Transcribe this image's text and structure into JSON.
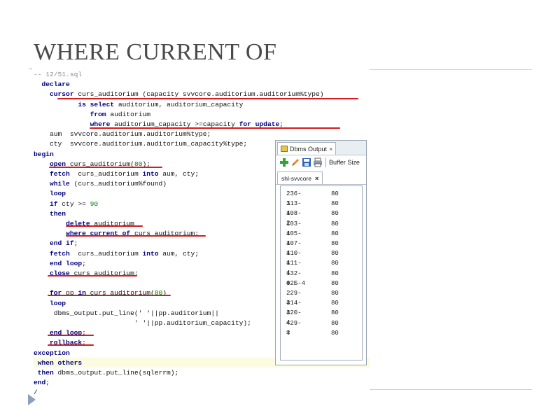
{
  "slide": {
    "title": "WHERE CURRENT OF"
  },
  "code": {
    "lines": [
      {
        "parts": [
          {
            "t": "-- 12/51.sql",
            "c": "cm"
          }
        ]
      },
      {
        "parts": [
          {
            "t": "  "
          },
          {
            "t": "declare",
            "c": "kw"
          }
        ]
      },
      {
        "parts": [
          {
            "t": "    "
          },
          {
            "t": "cursor",
            "c": "kw"
          },
          {
            "t": " curs_auditorium (capacity svvcore.auditorium.auditorium%type)"
          }
        ]
      },
      {
        "parts": [
          {
            "t": "           "
          },
          {
            "t": "is select",
            "c": "kw"
          },
          {
            "t": " auditorium, auditorium_capacity"
          }
        ]
      },
      {
        "parts": [
          {
            "t": "              "
          },
          {
            "t": "from",
            "c": "kw"
          },
          {
            "t": " auditorium"
          }
        ]
      },
      {
        "parts": [
          {
            "t": "              "
          },
          {
            "t": "where",
            "c": "kw"
          },
          {
            "t": " auditorium_capacity >=capacity "
          },
          {
            "t": "for update",
            "c": "kw"
          },
          {
            "t": ";"
          }
        ]
      },
      {
        "parts": [
          {
            "t": "    aum  svvcore.auditorium.auditorium%type;"
          }
        ]
      },
      {
        "parts": [
          {
            "t": "    cty  svvcore.auditorium.auditorium_capacity%type;"
          }
        ]
      },
      {
        "parts": [
          {
            "t": "begin",
            "c": "kw"
          }
        ]
      },
      {
        "parts": [
          {
            "t": "    "
          },
          {
            "t": "open",
            "c": "kw"
          },
          {
            "t": " curs_auditorium("
          },
          {
            "t": "80",
            "c": "num"
          },
          {
            "t": ");"
          }
        ]
      },
      {
        "parts": [
          {
            "t": "    "
          },
          {
            "t": "fetch",
            "c": "kw"
          },
          {
            "t": "  curs_auditorium "
          },
          {
            "t": "into",
            "c": "kw"
          },
          {
            "t": " aum, cty;"
          }
        ]
      },
      {
        "parts": [
          {
            "t": "    "
          },
          {
            "t": "while",
            "c": "kw"
          },
          {
            "t": " (curs_auditorium%found)"
          }
        ]
      },
      {
        "parts": [
          {
            "t": "    "
          },
          {
            "t": "loop",
            "c": "kw"
          }
        ]
      },
      {
        "parts": [
          {
            "t": "    "
          },
          {
            "t": "if",
            "c": "kw"
          },
          {
            "t": " cty >= "
          },
          {
            "t": "90",
            "c": "num"
          }
        ]
      },
      {
        "parts": [
          {
            "t": "    "
          },
          {
            "t": "then",
            "c": "kw"
          }
        ]
      },
      {
        "parts": [
          {
            "t": "        "
          },
          {
            "t": "delete",
            "c": "kw"
          },
          {
            "t": " auditorium"
          }
        ]
      },
      {
        "parts": [
          {
            "t": "        "
          },
          {
            "t": "where current of",
            "c": "kw"
          },
          {
            "t": " curs auditorium;"
          }
        ]
      },
      {
        "parts": [
          {
            "t": "    "
          },
          {
            "t": "end if",
            "c": "kw"
          },
          {
            "t": ";"
          }
        ]
      },
      {
        "parts": [
          {
            "t": "    "
          },
          {
            "t": "fetch",
            "c": "kw"
          },
          {
            "t": "  curs_auditorium "
          },
          {
            "t": "into",
            "c": "kw"
          },
          {
            "t": " aum, cty;"
          }
        ]
      },
      {
        "parts": [
          {
            "t": "    "
          },
          {
            "t": "end loop",
            "c": "kw"
          },
          {
            "t": ";"
          }
        ]
      },
      {
        "parts": [
          {
            "t": "    "
          },
          {
            "t": "close",
            "c": "kw"
          },
          {
            "t": " curs_auditorium;"
          }
        ]
      },
      {
        "parts": [
          {
            "t": ""
          }
        ]
      },
      {
        "parts": [
          {
            "t": "    "
          },
          {
            "t": "for",
            "c": "kw"
          },
          {
            "t": " pp "
          },
          {
            "t": "in",
            "c": "kw"
          },
          {
            "t": " curs_auditorium("
          },
          {
            "t": "80",
            "c": "num"
          },
          {
            "t": ")"
          }
        ]
      },
      {
        "parts": [
          {
            "t": "    "
          },
          {
            "t": "loop",
            "c": "kw"
          }
        ]
      },
      {
        "parts": [
          {
            "t": "     dbms_output.put_line(' '||pp.auditorium||"
          }
        ]
      },
      {
        "parts": [
          {
            "t": "                         ' '||pp.auditorium_capacity);"
          }
        ]
      },
      {
        "parts": [
          {
            "t": "    "
          },
          {
            "t": "end loop",
            "c": "kw"
          },
          {
            "t": ";"
          }
        ]
      },
      {
        "parts": [
          {
            "t": "    "
          },
          {
            "t": "rollback",
            "c": "kw"
          },
          {
            "t": ";"
          }
        ]
      },
      {
        "parts": [
          {
            "t": "exception",
            "c": "kw"
          }
        ]
      },
      {
        "parts": [
          {
            "t": " "
          },
          {
            "t": "when others",
            "c": "kw"
          }
        ]
      },
      {
        "parts": [
          {
            "t": " "
          },
          {
            "t": "then",
            "c": "kw"
          },
          {
            "t": " dbms_output.put_line(sqlerrm);"
          }
        ]
      },
      {
        "parts": [
          {
            "t": "end",
            "c": "kw"
          },
          {
            "t": ";"
          }
        ]
      },
      {
        "parts": [
          {
            "t": "/"
          }
        ]
      }
    ]
  },
  "dbms_output": {
    "tab_label": "Dbms Output",
    "close_glyph": "×",
    "buffer_label": "Buffer Size",
    "connection_tab": "shl-svvcore",
    "connection_close": "×",
    "rows": [
      [
        "236-1",
        "80"
      ],
      [
        "313-1",
        "80"
      ],
      [
        "408-2",
        "80"
      ],
      [
        "103-4",
        "80"
      ],
      [
        "105-4",
        "80"
      ],
      [
        "107-4",
        "80"
      ],
      [
        "110-4",
        "80"
      ],
      [
        "111-4",
        "80"
      ],
      [
        "132-4",
        "80"
      ],
      [
        "02Б-4",
        "80"
      ],
      [
        "229-4",
        "80"
      ],
      [
        "314-4",
        "80"
      ],
      [
        "320-4",
        "80"
      ],
      [
        "429-4",
        "80"
      ],
      [
        "?",
        "80"
      ]
    ]
  },
  "colors": {
    "underline": "#d41d1d",
    "keyword": "#000080",
    "number": "#008000",
    "highlight": "#fbfbe2"
  },
  "icons": [
    "add-icon",
    "edit-icon",
    "save-icon",
    "print-icon",
    "tab-icon",
    "nav-arrow-icon"
  ]
}
